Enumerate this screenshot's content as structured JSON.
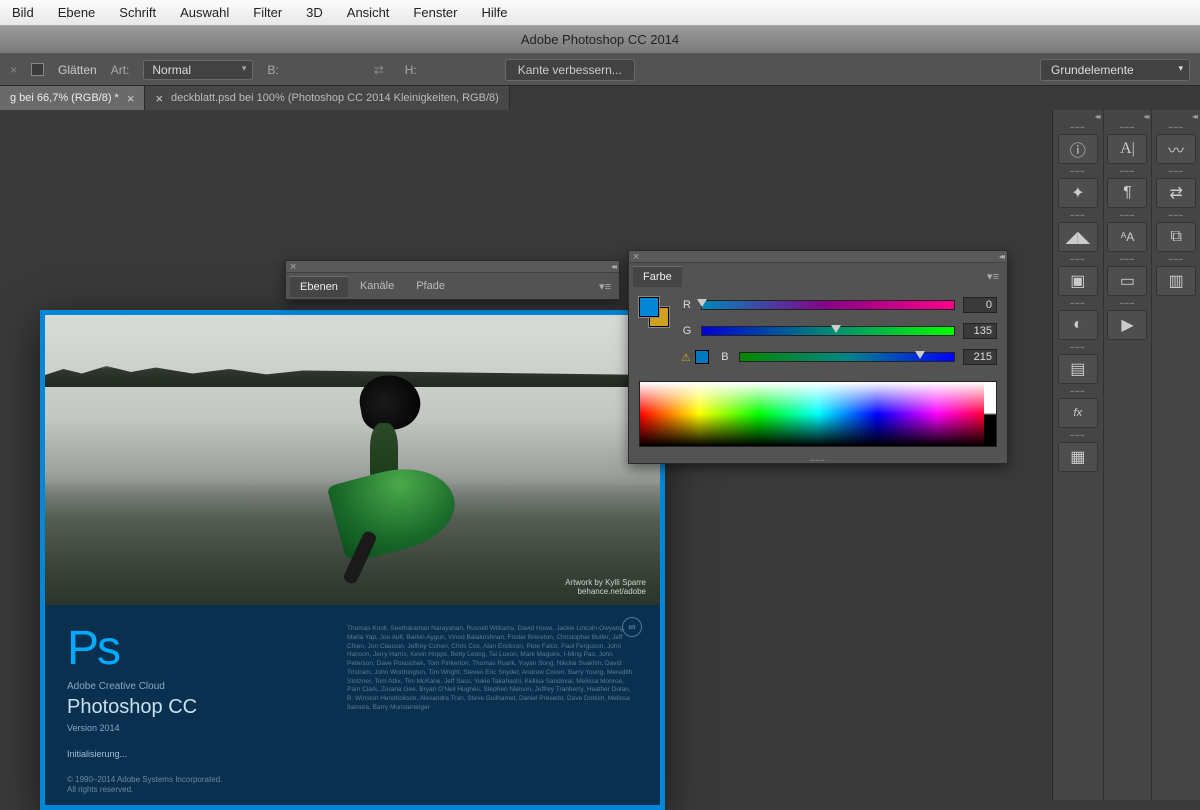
{
  "os_menu": [
    "Bild",
    "Ebene",
    "Schrift",
    "Auswahl",
    "Filter",
    "3D",
    "Ansicht",
    "Fenster",
    "Hilfe"
  ],
  "app_title": "Adobe Photoshop CC 2014",
  "options": {
    "glaetten": "Glätten",
    "art_label": "Art:",
    "art_value": "Normal",
    "b_label": "B:",
    "h_label": "H:",
    "refine_edge": "Kante verbessern...",
    "workspace": "Grundelemente"
  },
  "tabs": {
    "t1": "g bei 66,7% (RGB/8) *",
    "t2": "deckblatt.psd bei 100% (Photoshop CC 2014  Kleinigkeiten, RGB/8)"
  },
  "layers_panel": {
    "t1": "Ebenen",
    "t2": "Kanäle",
    "t3": "Pfade"
  },
  "color_panel": {
    "title": "Farbe",
    "r_label": "R",
    "r_value": "0",
    "g_label": "G",
    "g_value": "135",
    "b_label": "B",
    "b_value": "215",
    "fg": "#0087d7",
    "bg": "#d0a020"
  },
  "splash": {
    "ps": "Ps",
    "cloud": "Adobe Creative Cloud",
    "name": "Photoshop CC",
    "version": "Version 2014",
    "status": "Initialisierung...",
    "copyright1": "© 1990–2014 Adobe Systems Incorporated.",
    "copyright2": "All rights reserved.",
    "artwork1": "Artwork by Kylli Sparre",
    "artwork2": "behance.net/adobe",
    "credits": "Thomas Knoll, Seetharaman Narayanan, Russell Williams, David Howe, Jackie Lincoln-Owyang, Maria Yap, Joe Ault, Barkin Aygun, Vinod Balakrishnan, Foster Brereton, Christopher Butler, Jeff Chien, Jon Clauson, Jeffrey Cohen, Chris Cox, Alan Erickson, Pete Falco, Paul Ferguson, John Hanson, Jerry Harris, Kevin Hopps, Betty Leong, Tai Luxon, Mark Maguire, I-Ming Pao, John Peterson, Dave Polaschek, Tom Pinkerton, Thomas Ruark, Yuyan Song, Nikolai Svakhin, David Tristram, John Worthington, Tim Wright, Steven Eric Snyder, Andrew Coven, Barry Young, Meredith Stotzner, Tom Attix, Tim McKane, Jeff Sass, Yukie Takahashi, Kellisa Sandoval, Melissa Monroe, Pam Clark, Zorana Gee, Bryan O'Neil Hughes, Stephen Nielson, Jeffrey Tranberry, Heather Dolan, B. Winston Hendrickson, Alexandra Tran, Steve Guilhamet, Daniel Presedo, Dave Dobish, Melissa Itamura, Barry Munsterteiger"
  }
}
